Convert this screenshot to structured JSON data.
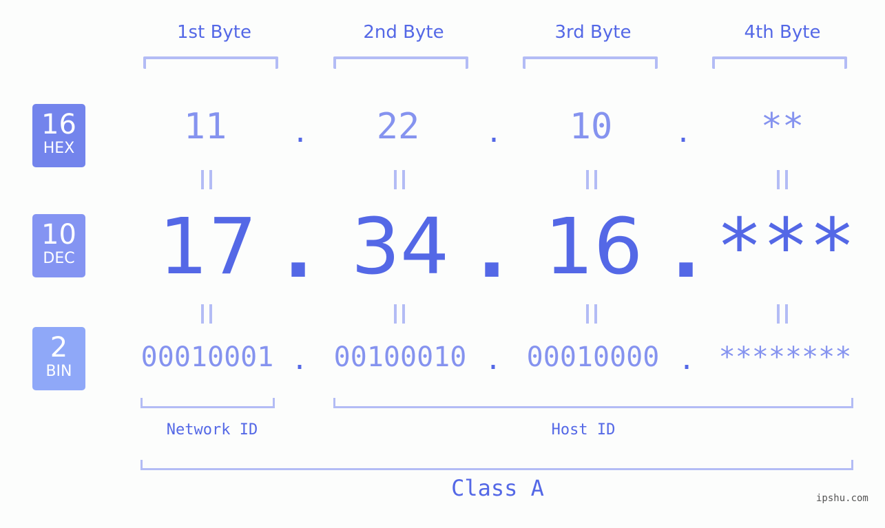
{
  "bases": [
    {
      "num": "16",
      "label": "HEX",
      "color": "#7384ec"
    },
    {
      "num": "10",
      "label": "DEC",
      "color": "#8494f2"
    },
    {
      "num": "2",
      "label": "BIN",
      "color": "#8fa8f8"
    }
  ],
  "byte_headers": [
    "1st Byte",
    "2nd Byte",
    "3rd Byte",
    "4th Byte"
  ],
  "hex": [
    "11",
    "22",
    "10",
    "**"
  ],
  "dec": [
    "17",
    "34",
    "16",
    "***"
  ],
  "bin": [
    "00010001",
    "00100010",
    "00010000",
    "********"
  ],
  "separator": ".",
  "equals": "||",
  "network_label": "Network ID",
  "host_label": "Host ID",
  "class_label": "Class A",
  "watermark": "ipshu.com",
  "colors": {
    "primary": "#5468e6",
    "light": "#8593ef",
    "bracket": "#b3bcf5"
  }
}
